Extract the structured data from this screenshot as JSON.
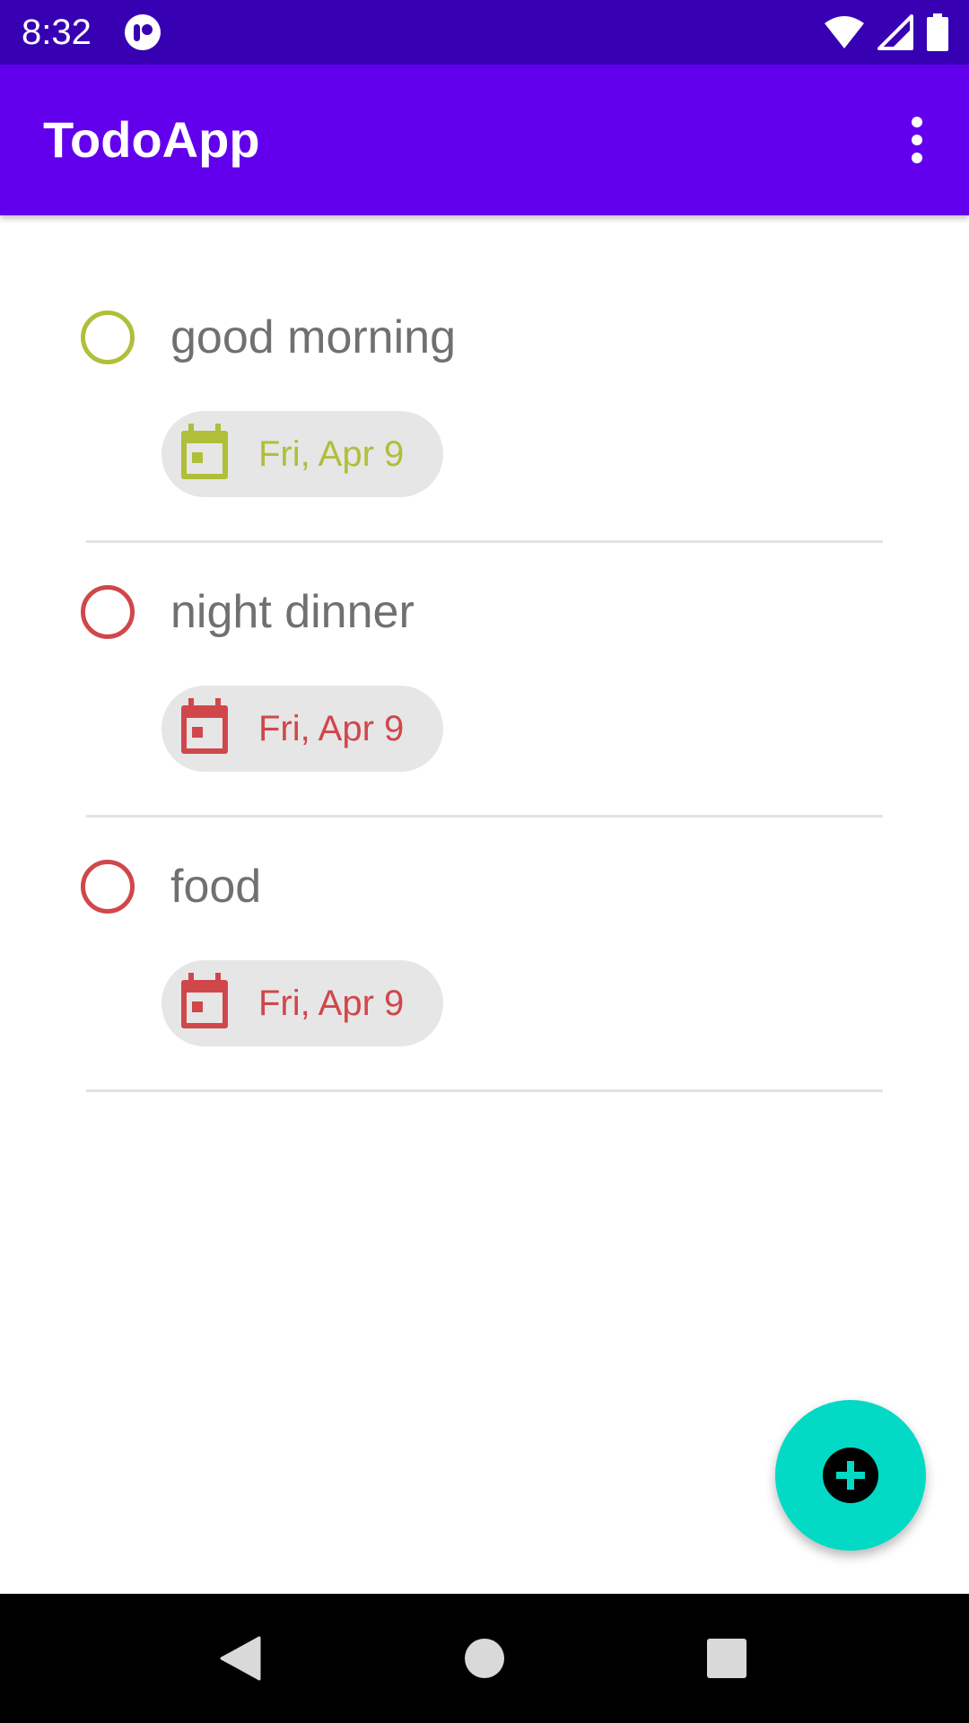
{
  "status_bar": {
    "time": "8:32",
    "icons": [
      "app-notification-icon",
      "wifi-icon",
      "cell-signal-icon",
      "battery-icon"
    ]
  },
  "app_bar": {
    "title": "TodoApp",
    "overflow_icon": "more-vert-icon"
  },
  "todos": [
    {
      "title": "good morning",
      "date": "Fri, Apr 9",
      "color": "#afbf3a",
      "done": false
    },
    {
      "title": "night dinner",
      "date": "Fri, Apr 9",
      "color": "#d0474b",
      "done": false
    },
    {
      "title": "food",
      "date": "Fri, Apr 9",
      "color": "#d0474b",
      "done": false
    }
  ],
  "fab": {
    "icon": "add-circle-icon",
    "color": "#03dac5"
  },
  "nav_bar": {
    "icons": [
      "back-icon",
      "home-icon",
      "recents-icon"
    ]
  },
  "colors": {
    "status_bar": "#3700b3",
    "app_bar": "#6200ee",
    "chip_bg": "#e6e6e6",
    "title_text": "#707070"
  }
}
